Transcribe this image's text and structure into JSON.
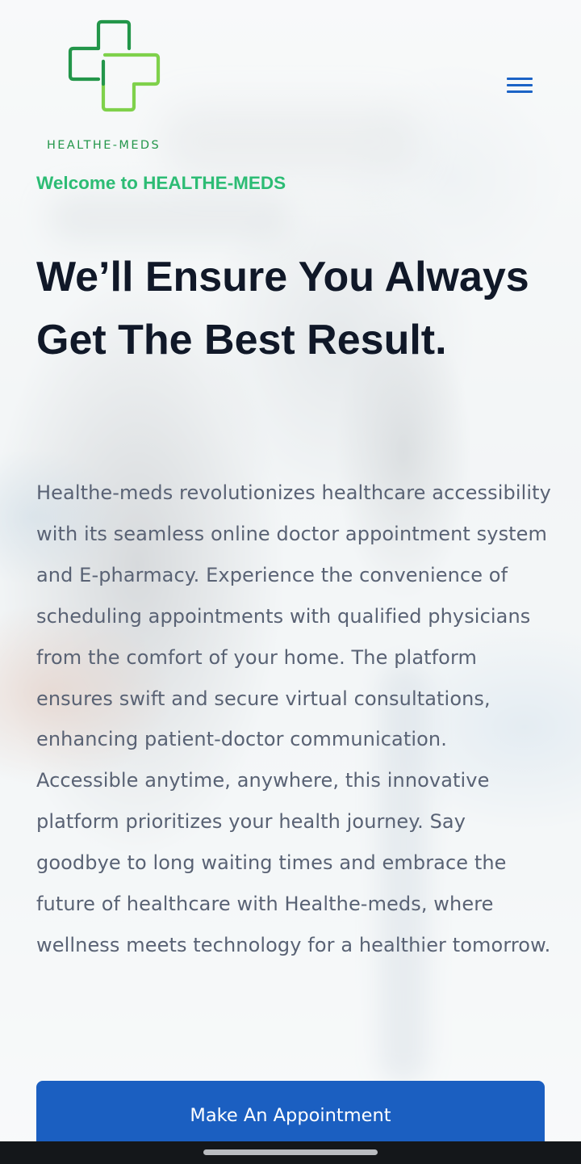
{
  "brand": {
    "logo_icon": "medical-cross-icon",
    "name": "HEALTHE-MEDS",
    "colors": {
      "logo_dark_green": "#23964a",
      "logo_light_green": "#7fd14b",
      "welcome_green": "#2cbc74",
      "primary_blue": "#1b5fc1"
    }
  },
  "header": {
    "menu_icon": "hamburger-menu-icon"
  },
  "hero": {
    "welcome": "Welcome to HEALTHE-MEDS",
    "headline": "We’ll Ensure You Always Get The Best Result.",
    "description": "Healthe-meds revolutionizes healthcare accessibility with its seamless online doctor appointment system and E-pharmacy. Experience the convenience of scheduling appointments with qualified physicians from the comfort of your home. The platform ensures swift and secure virtual consultations, enhancing patient-doctor communication.  Accessible anytime, anywhere, this innovative platform prioritizes your health journey. Say goodbye to long waiting times and embrace the future of healthcare with Healthe-meds, where wellness meets technology for a healthier tomorrow.",
    "cta_label": "Make An Appointment"
  },
  "system": {
    "nav_bar_color": "#14171a"
  }
}
